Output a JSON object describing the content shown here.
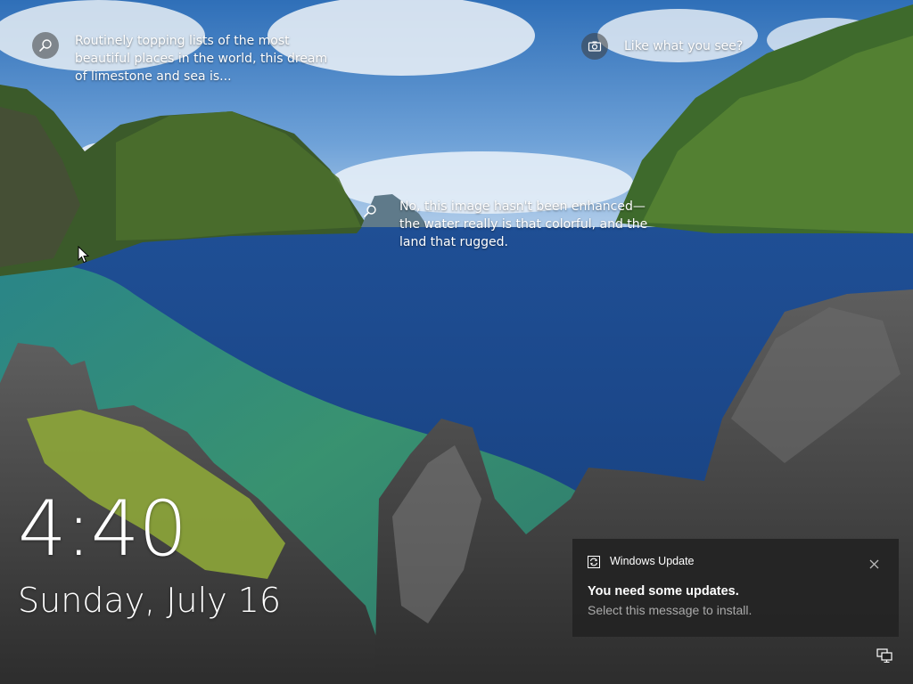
{
  "lockscreen": {
    "spotlight_hotspots": [
      {
        "icon": "search-icon",
        "lines": [
          "Routinely topping lists of the most",
          "beautiful places in the world, this dream",
          "of limestone and sea is..."
        ]
      },
      {
        "icon": "camera-icon",
        "lines": [
          "Like what you see?"
        ]
      },
      {
        "icon": "search-icon",
        "lines": [
          "No, this image hasn't been enhanced—",
          "the water really is that colorful, and the",
          "land that rugged."
        ]
      }
    ],
    "time": "4:40",
    "date": "Sunday, July 16"
  },
  "notification": {
    "app_icon": "windows-update-icon",
    "app_name": "Windows Update",
    "title": "You need some updates.",
    "body": "Select this message to install.",
    "close_icon": "close-icon",
    "background": "#242424"
  },
  "tray": {
    "network_icon": "network-icon"
  }
}
